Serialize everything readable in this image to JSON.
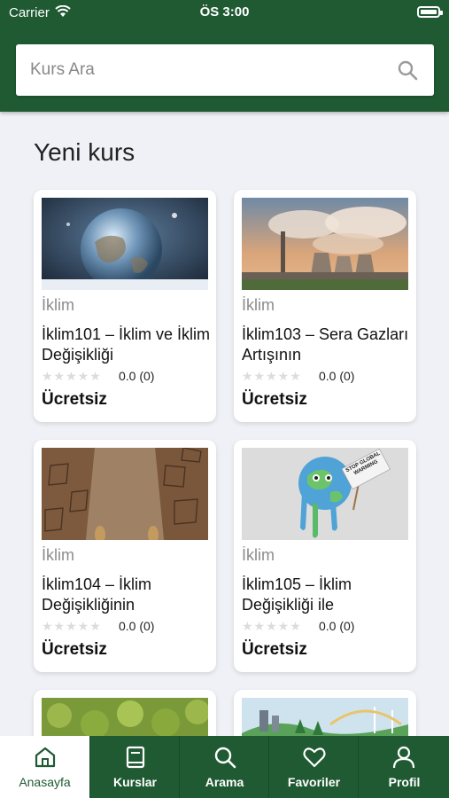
{
  "status_bar": {
    "carrier": "Carrier",
    "time": "ÖS 3:00"
  },
  "search": {
    "placeholder": "Kurs Ara"
  },
  "section": {
    "title": "Yeni kurs"
  },
  "courses": [
    {
      "category": "İklim",
      "title": "İklim101 – İklim ve İklim Değişikliği",
      "rating": "0.0 (0)",
      "price": "Ücretsiz",
      "image": "globe-image"
    },
    {
      "category": "İklim",
      "title": "İklim103 – Sera Gazları Artışının",
      "rating": "0.0 (0)",
      "price": "Ücretsiz",
      "image": "factory-image"
    },
    {
      "category": "İklim",
      "title": "İklim104 – İklim Değişikliğinin",
      "rating": "0.0 (0)",
      "price": "Ücretsiz",
      "image": "drought-image"
    },
    {
      "category": "İklim",
      "title": "İklim105 – İklim Değişikliği ile",
      "rating": "0.0 (0)",
      "price": "Ücretsiz",
      "image": "melting-globe-image",
      "sign_text": "STOP GLOBAL WARMING"
    }
  ],
  "tabs": [
    {
      "label": "Anasayfa",
      "icon": "home-icon",
      "active": true
    },
    {
      "label": "Kurslar",
      "icon": "book-icon",
      "active": false
    },
    {
      "label": "Arama",
      "icon": "search-icon",
      "active": false
    },
    {
      "label": "Favoriler",
      "icon": "heart-icon",
      "active": false
    },
    {
      "label": "Profil",
      "icon": "person-icon",
      "active": false
    }
  ],
  "colors": {
    "primary": "#1f5a33",
    "background": "#f0f1f6"
  }
}
